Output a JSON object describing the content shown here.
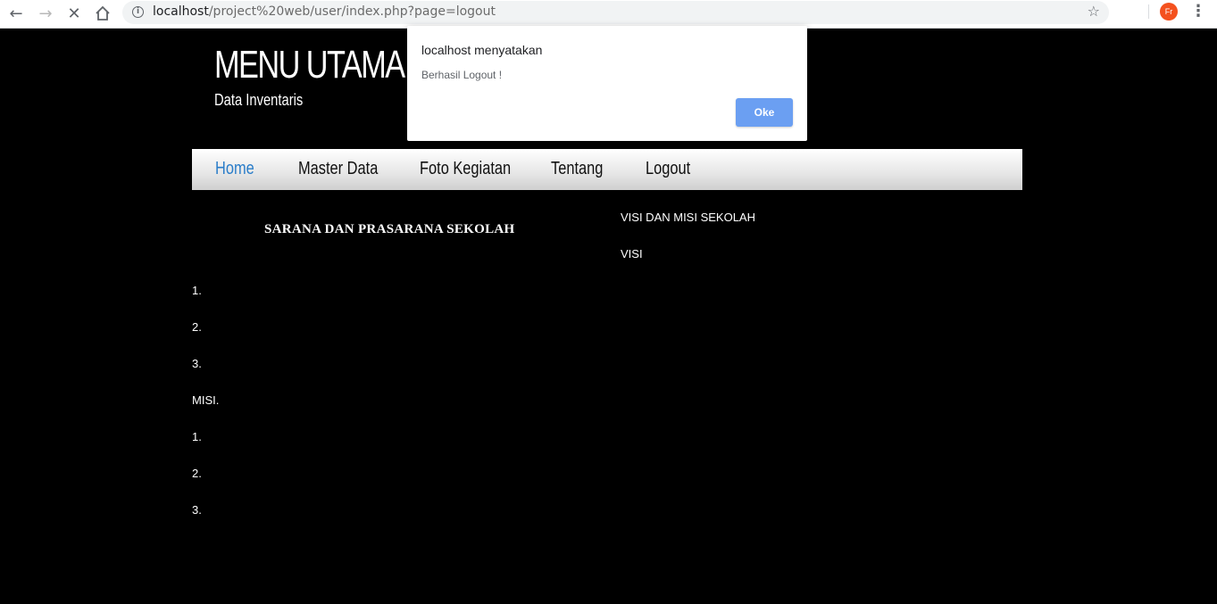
{
  "browser": {
    "url_host": "localhost",
    "url_path": "/project%20web/user/index.php?page=logout",
    "avatar_initials": "Fr",
    "icons": [
      "back-icon",
      "forward-icon",
      "stop-icon",
      "home-icon",
      "info-icon",
      "star-icon",
      "menu-icon"
    ]
  },
  "header": {
    "title": "MENU UTAMA",
    "subtitle": "Data Inventaris"
  },
  "nav": {
    "items": [
      {
        "label": "Home"
      },
      {
        "label": "Master Data"
      },
      {
        "label": "Foto Kegiatan"
      },
      {
        "label": "Tentang"
      },
      {
        "label": "Logout"
      }
    ],
    "active_color": "#2a7dc9"
  },
  "left": {
    "heading": "SARANA DAN PRASARANA SEKOLAH"
  },
  "right": {
    "heading": "VISI DAN MISI SEKOLAH",
    "visi_label": "VISI"
  },
  "list": {
    "visi_items": [
      "1.",
      "2.",
      "3."
    ],
    "misi_label": "MISI.",
    "misi_items": [
      "1.",
      "2.",
      "3."
    ]
  },
  "dialog": {
    "title": "localhost menyatakan",
    "message": "Berhasil Logout !",
    "ok_label": "Oke",
    "ok_color": "#6b9ff2"
  }
}
